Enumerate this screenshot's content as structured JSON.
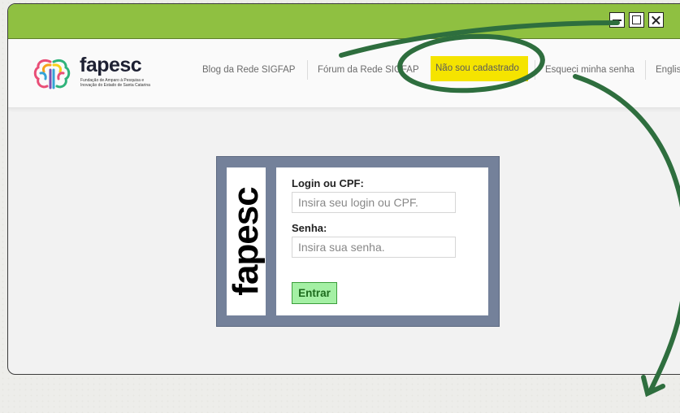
{
  "window": {
    "controls": {
      "minimize": "minimize",
      "maximize": "maximize",
      "close": "close"
    },
    "accent_color": "#8fc041"
  },
  "logo": {
    "word": "fapesc",
    "subtitle": "Fundação de Amparo à Pesquisa e Inovação do Estado de Santa Catarina"
  },
  "nav": {
    "items": [
      {
        "label": "Blog da Rede SIGFAP"
      },
      {
        "label": "Fórum da Rede SIGFAP"
      },
      {
        "label": "Não sou cadastrado"
      },
      {
        "label": "Esqueci minha senha"
      },
      {
        "label": "English"
      }
    ],
    "highlight_color": "#f5e400"
  },
  "login": {
    "panel_logo_text": "fapesc",
    "login_label": "Login ou CPF:",
    "login_placeholder": "Insira seu login ou CPF.",
    "password_label": "Senha:",
    "password_placeholder": "Insira sua senha.",
    "submit_label": "Entrar"
  },
  "annotation": {
    "color": "#2e6e3e"
  }
}
